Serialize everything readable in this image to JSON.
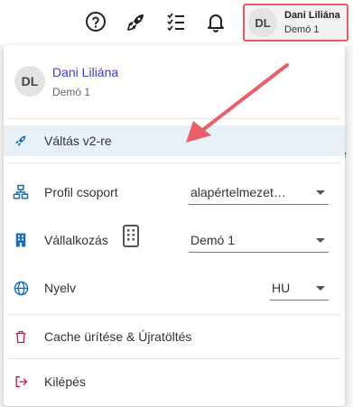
{
  "header": {
    "icons": [
      "help-icon",
      "rocket-icon",
      "checklist-icon",
      "bell-icon"
    ],
    "user": {
      "initials": "DL",
      "name": "Dani Liliána",
      "company": "Demó 1"
    }
  },
  "menu": {
    "user": {
      "initials": "DL",
      "name": "Dani Liliána",
      "company": "Demó 1"
    },
    "switch_v2": {
      "label": "Váltás v2-re",
      "icon": "rocket-icon"
    },
    "profile_group": {
      "label": "Profil csoport",
      "value": "alapértelmezet…",
      "icon": "org-chart-icon"
    },
    "business": {
      "label": "Vállalkozás",
      "value": "Demó 1",
      "icon": "building-icon"
    },
    "language": {
      "label": "Nyelv",
      "value": "HU",
      "icon": "globe-icon"
    },
    "cache": {
      "label": "Cache ürítése & Újratöltés",
      "icon": "trash-icon"
    },
    "logout": {
      "label": "Kilépés",
      "icon": "logout-icon"
    }
  },
  "colors": {
    "accent_blue": "#1a6fb3",
    "highlight_border": "#e35d6a",
    "arrow": "#e8606c",
    "name_link": "#3b3bd6",
    "logout_pink": "#c2185b"
  }
}
